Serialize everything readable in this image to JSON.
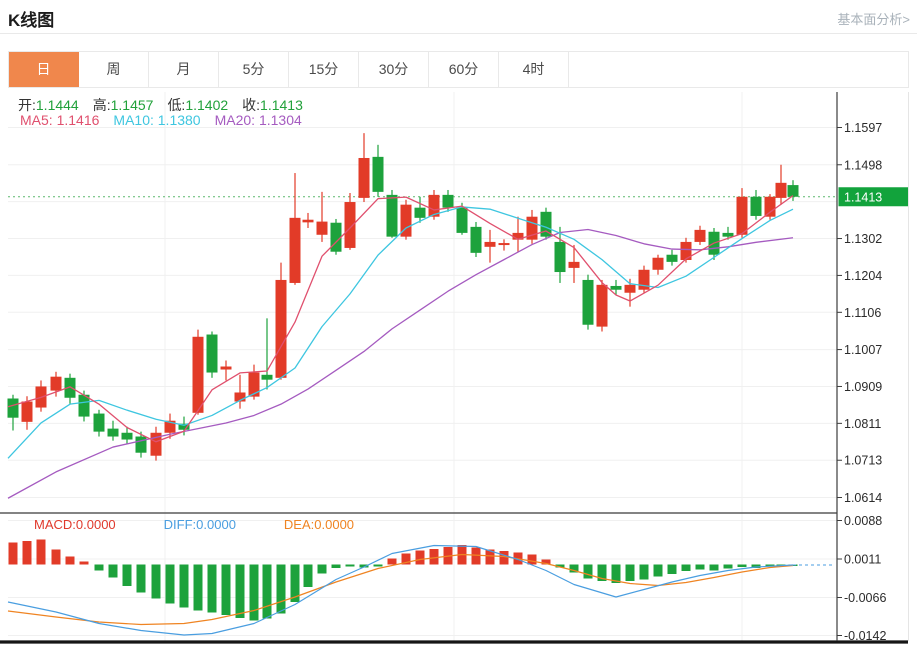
{
  "header": {
    "title": "K线图",
    "link": "基本面分析>"
  },
  "tabs": [
    {
      "name": "tab-day",
      "label": "日",
      "active": true
    },
    {
      "name": "tab-week",
      "label": "周",
      "active": false
    },
    {
      "name": "tab-month",
      "label": "月",
      "active": false
    },
    {
      "name": "tab-5min",
      "label": "5分",
      "active": false
    },
    {
      "name": "tab-15min",
      "label": "15分",
      "active": false
    },
    {
      "name": "tab-30min",
      "label": "30分",
      "active": false
    },
    {
      "name": "tab-60min",
      "label": "60分",
      "active": false
    },
    {
      "name": "tab-4hour",
      "label": "4时",
      "active": false
    }
  ],
  "legend": {
    "open_label": "开:",
    "open": "1.1444",
    "high_label": "高:",
    "high": "1.1457",
    "low_label": "低:",
    "low": "1.1402",
    "close_label": "收:",
    "close": "1.1413",
    "ma5_label": "MA5:",
    "ma5": "1.1416",
    "ma10_label": "MA10:",
    "ma10": "1.1380",
    "ma20_label": "MA20:",
    "ma20": "1.1304",
    "macd_label": "MACD:",
    "macd": "0.0000",
    "diff_label": "DIFF:",
    "diff": "0.0000",
    "dea_label": "DEA:",
    "dea": "0.0000"
  },
  "colors": {
    "up": "#e23b28",
    "down": "#1da23c",
    "value_green": "#21a13a",
    "ma5": "#e0506e",
    "ma10": "#3ec6e0",
    "ma20": "#a55bc0",
    "diff": "#4a9ee0",
    "dea": "#ef8422",
    "macd_text": "#e0392c",
    "tab_accent": "#f0874c",
    "badge": "#12a33c",
    "dotted_line": "#5cb86e",
    "grid": "#f0f0f0",
    "axis_text": "#2b2b2b"
  },
  "chart_data": {
    "type": "candlestick_with_macd",
    "title": "K线图",
    "price_axis": {
      "ticks": [
        {
          "price": 1.1597,
          "label": "1.1597"
        },
        {
          "price": 1.1498,
          "label": "1.1498"
        },
        {
          "price": 1.14,
          "label": ""
        },
        {
          "price": 1.1302,
          "label": "1.1302"
        },
        {
          "price": 1.1204,
          "label": "1.1204"
        },
        {
          "price": 1.1106,
          "label": "1.1106"
        },
        {
          "price": 1.1007,
          "label": "1.1007"
        },
        {
          "price": 1.0909,
          "label": "1.0909"
        },
        {
          "price": 1.0811,
          "label": "1.0811"
        },
        {
          "price": 1.0713,
          "label": "1.0713"
        },
        {
          "price": 1.0614,
          "label": "1.0614"
        }
      ],
      "current": {
        "price": 1.1413,
        "label": "1.1413"
      }
    },
    "macd_axis": {
      "ticks": [
        {
          "value": 0.0088,
          "label": "0.0088"
        },
        {
          "value": 0.0011,
          "label": "0.0011"
        },
        {
          "value": -0.0066,
          "label": "-0.0066"
        },
        {
          "value": -0.0142,
          "label": "-0.0142"
        }
      ]
    },
    "candles": [
      [
        13,
        1.0877,
        1.0887,
        1.0792,
        1.0826
      ],
      [
        27,
        1.0815,
        1.0883,
        1.0794,
        1.0869
      ],
      [
        41,
        1.0853,
        1.0925,
        1.0842,
        1.0909
      ],
      [
        56,
        1.0898,
        1.0948,
        1.0882,
        1.0935
      ],
      [
        70,
        1.0932,
        1.0943,
        1.0863,
        1.0879
      ],
      [
        84,
        1.0887,
        1.0898,
        1.0816,
        1.0829
      ],
      [
        99,
        1.0837,
        1.0847,
        1.0776,
        1.0789
      ],
      [
        113,
        1.0797,
        1.0818,
        1.0765,
        1.0776
      ],
      [
        127,
        1.0786,
        1.0802,
        1.0755,
        1.0768
      ],
      [
        141,
        1.0776,
        1.0789,
        1.072,
        1.0733
      ],
      [
        156,
        1.0725,
        1.0802,
        1.0712,
        1.0786
      ],
      [
        170,
        1.0786,
        1.0837,
        1.077,
        1.0818
      ],
      [
        184,
        1.081,
        1.0829,
        1.0779,
        1.0794
      ],
      [
        198,
        1.0839,
        1.106,
        1.0834,
        1.1041
      ],
      [
        212,
        1.1047,
        1.1055,
        1.0932,
        1.0946
      ],
      [
        226,
        1.0954,
        1.0978,
        1.0925,
        1.0962
      ],
      [
        240,
        1.0869,
        1.094,
        1.085,
        1.0893
      ],
      [
        254,
        1.0882,
        1.0967,
        1.0874,
        1.0946
      ],
      [
        267,
        1.094,
        1.109,
        1.0901,
        1.0927
      ],
      [
        281,
        1.0932,
        1.1238,
        1.0927,
        1.1192
      ],
      [
        295,
        1.1184,
        1.1476,
        1.1179,
        1.1357
      ],
      [
        308,
        1.1345,
        1.137,
        1.133,
        1.1352
      ],
      [
        322,
        1.1312,
        1.1426,
        1.1293,
        1.1347
      ],
      [
        336,
        1.1344,
        1.1354,
        1.1259,
        1.1267
      ],
      [
        350,
        1.1277,
        1.1423,
        1.1272,
        1.1399
      ],
      [
        364,
        1.141,
        1.1582,
        1.1399,
        1.1516
      ],
      [
        378,
        1.1519,
        1.1551,
        1.1413,
        1.1426
      ],
      [
        392,
        1.1418,
        1.1431,
        1.1304,
        1.1307
      ],
      [
        406,
        1.1307,
        1.1405,
        1.1299,
        1.1392
      ],
      [
        420,
        1.1384,
        1.1413,
        1.1344,
        1.1357
      ],
      [
        434,
        1.136,
        1.1431,
        1.1352,
        1.1418
      ],
      [
        448,
        1.1418,
        1.1431,
        1.1373,
        1.1384
      ],
      [
        462,
        1.1384,
        1.1397,
        1.1312,
        1.1317
      ],
      [
        476,
        1.1333,
        1.1346,
        1.1253,
        1.1264
      ],
      [
        490,
        1.128,
        1.1325,
        1.1238,
        1.1293
      ],
      [
        504,
        1.1285,
        1.13,
        1.127,
        1.129
      ],
      [
        518,
        1.1299,
        1.136,
        1.1267,
        1.1317
      ],
      [
        532,
        1.1299,
        1.1378,
        1.1288,
        1.136
      ],
      [
        546,
        1.1373,
        1.1384,
        1.1299,
        1.1307
      ],
      [
        560,
        1.1293,
        1.1333,
        1.1184,
        1.1213
      ],
      [
        574,
        1.1224,
        1.1285,
        1.1184,
        1.124
      ],
      [
        588,
        1.1192,
        1.1206,
        1.106,
        1.1073
      ],
      [
        602,
        1.1068,
        1.1192,
        1.1055,
        1.1179
      ],
      [
        616,
        1.1176,
        1.1192,
        1.1152,
        1.1166
      ],
      [
        630,
        1.1158,
        1.1195,
        1.1121,
        1.1179
      ],
      [
        644,
        1.1166,
        1.123,
        1.1158,
        1.1219
      ],
      [
        658,
        1.1219,
        1.1259,
        1.1206,
        1.1251
      ],
      [
        672,
        1.1259,
        1.1272,
        1.123,
        1.124
      ],
      [
        686,
        1.1245,
        1.1304,
        1.1238,
        1.1293
      ],
      [
        700,
        1.1293,
        1.1336,
        1.1285,
        1.1325
      ],
      [
        714,
        1.132,
        1.133,
        1.1245,
        1.1259
      ],
      [
        728,
        1.1317,
        1.1333,
        1.1299,
        1.1307
      ],
      [
        742,
        1.1312,
        1.1436,
        1.1304,
        1.1413
      ],
      [
        756,
        1.1413,
        1.1431,
        1.1352,
        1.1362
      ],
      [
        770,
        1.136,
        1.142,
        1.1352,
        1.1413
      ],
      [
        781,
        1.141,
        1.1498,
        1.1392,
        1.145
      ],
      [
        793,
        1.1444,
        1.1457,
        1.1402,
        1.1413
      ]
    ],
    "ma5": [
      [
        8,
        1.0855
      ],
      [
        41,
        1.088
      ],
      [
        70,
        1.0908
      ],
      [
        99,
        1.0862
      ],
      [
        127,
        1.08
      ],
      [
        156,
        1.0762
      ],
      [
        184,
        1.079
      ],
      [
        212,
        1.09
      ],
      [
        240,
        1.0945
      ],
      [
        267,
        1.095
      ],
      [
        295,
        1.108
      ],
      [
        322,
        1.1255
      ],
      [
        350,
        1.133
      ],
      [
        378,
        1.1408
      ],
      [
        406,
        1.1412
      ],
      [
        434,
        1.1378
      ],
      [
        462,
        1.1388
      ],
      [
        490,
        1.1342
      ],
      [
        518,
        1.13
      ],
      [
        546,
        1.1322
      ],
      [
        574,
        1.1278
      ],
      [
        602,
        1.1185
      ],
      [
        616,
        1.1152
      ],
      [
        630,
        1.1136
      ],
      [
        658,
        1.1178
      ],
      [
        686,
        1.1248
      ],
      [
        714,
        1.129
      ],
      [
        742,
        1.1315
      ],
      [
        770,
        1.1372
      ],
      [
        793,
        1.1416
      ]
    ],
    "ma10": [
      [
        8,
        1.0718
      ],
      [
        41,
        1.0812
      ],
      [
        70,
        1.0862
      ],
      [
        99,
        1.0872
      ],
      [
        127,
        1.0846
      ],
      [
        156,
        1.0822
      ],
      [
        184,
        1.0806
      ],
      [
        212,
        1.0832
      ],
      [
        240,
        1.0872
      ],
      [
        267,
        1.0906
      ],
      [
        295,
        1.0958
      ],
      [
        322,
        1.1068
      ],
      [
        350,
        1.1155
      ],
      [
        378,
        1.1258
      ],
      [
        406,
        1.133
      ],
      [
        434,
        1.1366
      ],
      [
        462,
        1.1386
      ],
      [
        490,
        1.138
      ],
      [
        518,
        1.1356
      ],
      [
        546,
        1.1332
      ],
      [
        574,
        1.13
      ],
      [
        602,
        1.1246
      ],
      [
        630,
        1.1182
      ],
      [
        658,
        1.1172
      ],
      [
        686,
        1.1202
      ],
      [
        714,
        1.1252
      ],
      [
        742,
        1.1302
      ],
      [
        770,
        1.135
      ],
      [
        793,
        1.138
      ]
    ],
    "ma20": [
      [
        8,
        1.0612
      ],
      [
        56,
        1.0682
      ],
      [
        113,
        1.0748
      ],
      [
        170,
        1.0782
      ],
      [
        226,
        1.0812
      ],
      [
        254,
        1.0832
      ],
      [
        281,
        1.0862
      ],
      [
        308,
        1.0902
      ],
      [
        336,
        1.0952
      ],
      [
        364,
        1.1002
      ],
      [
        392,
        1.1062
      ],
      [
        420,
        1.1112
      ],
      [
        448,
        1.1162
      ],
      [
        476,
        1.1206
      ],
      [
        504,
        1.1246
      ],
      [
        532,
        1.1286
      ],
      [
        560,
        1.1318
      ],
      [
        588,
        1.1326
      ],
      [
        616,
        1.131
      ],
      [
        644,
        1.1288
      ],
      [
        672,
        1.1274
      ],
      [
        700,
        1.1272
      ],
      [
        728,
        1.128
      ],
      [
        756,
        1.1292
      ],
      [
        793,
        1.1304
      ]
    ],
    "macd_bars": [
      [
        13,
        0.0044
      ],
      [
        27,
        0.0047
      ],
      [
        41,
        0.005
      ],
      [
        56,
        0.003
      ],
      [
        70,
        0.0016
      ],
      [
        84,
        0.0006
      ],
      [
        99,
        -0.0012
      ],
      [
        113,
        -0.0026
      ],
      [
        127,
        -0.0043
      ],
      [
        141,
        -0.0056
      ],
      [
        156,
        -0.0068
      ],
      [
        170,
        -0.0078
      ],
      [
        184,
        -0.0086
      ],
      [
        198,
        -0.0092
      ],
      [
        212,
        -0.0096
      ],
      [
        226,
        -0.0101
      ],
      [
        240,
        -0.0107
      ],
      [
        254,
        -0.0112
      ],
      [
        267,
        -0.0108
      ],
      [
        281,
        -0.0098
      ],
      [
        295,
        -0.0075
      ],
      [
        308,
        -0.0045
      ],
      [
        322,
        -0.0018
      ],
      [
        336,
        -0.0007
      ],
      [
        350,
        -0.0004
      ],
      [
        364,
        -0.0006
      ],
      [
        378,
        -0.0004
      ],
      [
        392,
        0.0012
      ],
      [
        406,
        0.0022
      ],
      [
        420,
        0.0028
      ],
      [
        434,
        0.0031
      ],
      [
        448,
        0.0035
      ],
      [
        462,
        0.0039
      ],
      [
        476,
        0.0034
      ],
      [
        490,
        0.003
      ],
      [
        504,
        0.0027
      ],
      [
        518,
        0.0024
      ],
      [
        532,
        0.002
      ],
      [
        546,
        0.001
      ],
      [
        560,
        -0.0006
      ],
      [
        574,
        -0.0016
      ],
      [
        588,
        -0.0028
      ],
      [
        602,
        -0.0033
      ],
      [
        616,
        -0.0037
      ],
      [
        630,
        -0.0033
      ],
      [
        644,
        -0.003
      ],
      [
        658,
        -0.0024
      ],
      [
        672,
        -0.0019
      ],
      [
        686,
        -0.0013
      ],
      [
        700,
        -0.001
      ],
      [
        714,
        -0.0012
      ],
      [
        728,
        -0.0008
      ],
      [
        742,
        -0.0005
      ],
      [
        756,
        -0.0007
      ],
      [
        770,
        -0.0003
      ],
      [
        781,
        -0.0002
      ],
      [
        793,
        -0.0001
      ]
    ],
    "diff": [
      [
        8,
        -0.0075
      ],
      [
        56,
        -0.0095
      ],
      [
        99,
        -0.0118
      ],
      [
        141,
        -0.0132
      ],
      [
        184,
        -0.0141
      ],
      [
        212,
        -0.0138
      ],
      [
        254,
        -0.0118
      ],
      [
        295,
        -0.008
      ],
      [
        336,
        -0.003
      ],
      [
        364,
        -0.0005
      ],
      [
        392,
        0.0022
      ],
      [
        434,
        0.0038
      ],
      [
        476,
        0.0036
      ],
      [
        518,
        0.001
      ],
      [
        546,
        -0.0012
      ],
      [
        574,
        -0.004
      ],
      [
        616,
        -0.0065
      ],
      [
        644,
        -0.005
      ],
      [
        672,
        -0.0035
      ],
      [
        700,
        -0.0022
      ],
      [
        728,
        -0.0012
      ],
      [
        756,
        -0.0005
      ],
      [
        793,
        -0.0001
      ]
    ],
    "dea": [
      [
        8,
        -0.0093
      ],
      [
        56,
        -0.0105
      ],
      [
        99,
        -0.0115
      ],
      [
        141,
        -0.012
      ],
      [
        184,
        -0.0118
      ],
      [
        212,
        -0.011
      ],
      [
        254,
        -0.0092
      ],
      [
        295,
        -0.0065
      ],
      [
        336,
        -0.0035
      ],
      [
        378,
        -0.0008
      ],
      [
        420,
        0.001
      ],
      [
        462,
        0.002
      ],
      [
        504,
        0.0016
      ],
      [
        546,
        0.0002
      ],
      [
        574,
        -0.0012
      ],
      [
        602,
        -0.0028
      ],
      [
        630,
        -0.0038
      ],
      [
        658,
        -0.0042
      ],
      [
        686,
        -0.0036
      ],
      [
        714,
        -0.0026
      ],
      [
        742,
        -0.0015
      ],
      [
        770,
        -0.0006
      ],
      [
        793,
        -0.0002
      ]
    ]
  }
}
